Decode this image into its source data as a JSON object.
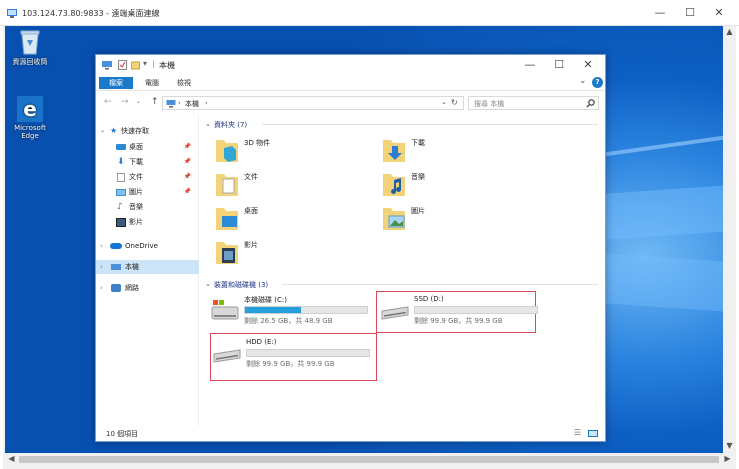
{
  "rdp": {
    "title": "103.124.73.80:9833 - 遠端桌面連線",
    "minimize": "—",
    "maximize": "☐",
    "close": "✕"
  },
  "desktop": {
    "icons": [
      {
        "label": "資源回收筒",
        "icon": "recycle-bin-icon"
      },
      {
        "label": "Microsoft Edge",
        "icon": "edge-icon"
      }
    ]
  },
  "explorer": {
    "title": "本機",
    "qat_separator": "|",
    "minimize": "—",
    "maximize": "☐",
    "close": "✕",
    "ribbon_tabs": [
      "檔案",
      "電腦",
      "檢視"
    ],
    "ribbon_expand": "⌄",
    "help": "?",
    "nav": {
      "back": "←",
      "forward": "→",
      "up": "↑",
      "dropdown": "⌄",
      "refresh": "↻"
    },
    "address": {
      "chevron1": "›",
      "location": "本機",
      "chevron2": "›"
    },
    "search": {
      "placeholder": "搜尋 本機"
    },
    "sidebar": {
      "quick_access": "快速存取",
      "quick_items": [
        {
          "label": "桌面",
          "icon": "desktop-icon",
          "pinned": true
        },
        {
          "label": "下載",
          "icon": "download-icon",
          "pinned": true
        },
        {
          "label": "文件",
          "icon": "documents-icon",
          "pinned": true
        },
        {
          "label": "圖片",
          "icon": "pictures-icon",
          "pinned": true
        },
        {
          "label": "音樂",
          "icon": "music-icon",
          "pinned": false
        },
        {
          "label": "影片",
          "icon": "videos-icon",
          "pinned": false
        }
      ],
      "onedrive": "OneDrive",
      "this_pc": "本機",
      "network": "網路"
    },
    "folders_header": "資料夾 (7)",
    "folders": [
      {
        "name": "3D 物件",
        "icon": "3d-objects-icon"
      },
      {
        "name": "下載",
        "icon": "downloads-folder-icon"
      },
      {
        "name": "文件",
        "icon": "documents-folder-icon"
      },
      {
        "name": "音樂",
        "icon": "music-folder-icon"
      },
      {
        "name": "桌面",
        "icon": "desktop-folder-icon"
      },
      {
        "name": "圖片",
        "icon": "pictures-folder-icon"
      },
      {
        "name": "影片",
        "icon": "videos-folder-icon"
      }
    ],
    "drives_header": "裝置和磁碟機 (3)",
    "drives": [
      {
        "name": "本機磁碟 (C:)",
        "free": "剩餘 26.5 GB，共 48.9 GB",
        "used_fraction": 0.46,
        "highlight": false
      },
      {
        "name": "SSD (D:)",
        "free": "剩餘 99.9 GB，共 99.9 GB",
        "used_fraction": 0.0,
        "highlight": true
      },
      {
        "name": "HDD (E:)",
        "free": "剩餘 99.9 GB，共 99.9 GB",
        "used_fraction": 0.0,
        "highlight": true
      }
    ],
    "status": "10 個項目"
  },
  "colors": {
    "accent": "#1979ca",
    "highlight_box": "#e0485a",
    "drive_fill": "#26a0da",
    "desktop_blue": "#0d5fc3"
  }
}
